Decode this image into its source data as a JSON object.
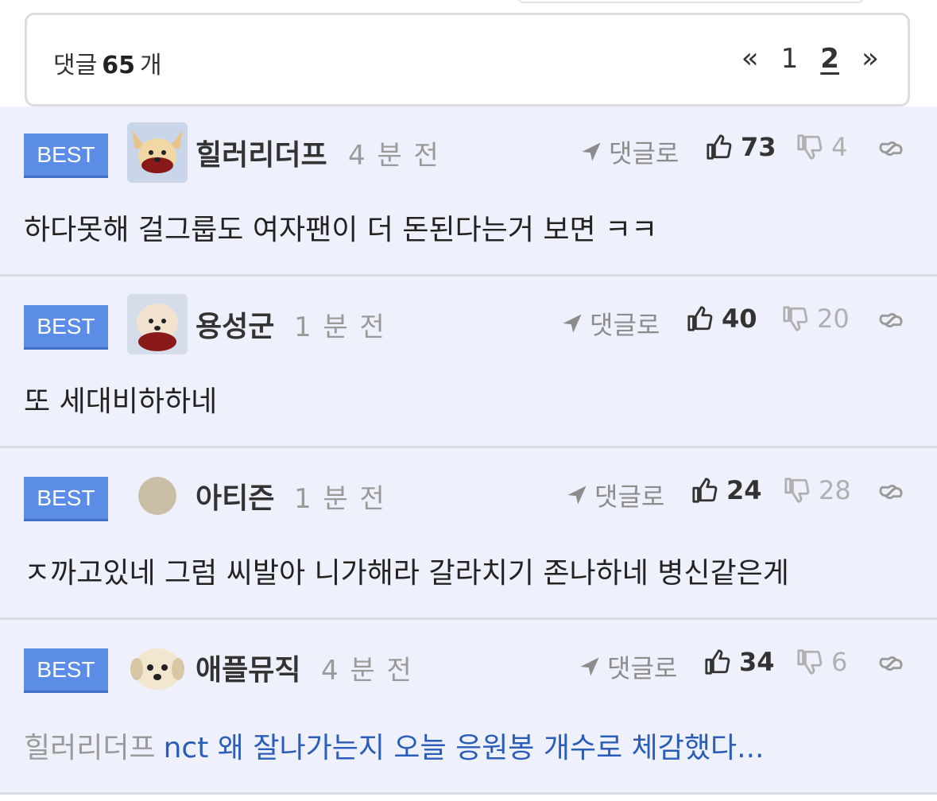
{
  "header": {
    "count_prefix": "댓글",
    "count": "65",
    "count_suffix": "개",
    "pager": {
      "prev": "«",
      "pages": [
        "1",
        "2"
      ],
      "current": "2",
      "next": "»"
    }
  },
  "colors": {
    "best_badge": "#5b8de6",
    "background": "#eef1fb",
    "link_text": "#2a5db9"
  },
  "comments": [
    {
      "badge": "BEST",
      "avatar": "dog-avatar-icon",
      "user": "힐러리더프",
      "time": "4 분 전",
      "reply": "댓글로",
      "likes": "73",
      "dislikes": "4",
      "body": "하다못해 걸그룹도 여자팬이 더 돈된다는거 보면 ㅋㅋ",
      "mention": ""
    },
    {
      "badge": "BEST",
      "avatar": "dog-avatar-icon",
      "user": "용성군",
      "time": "1 분 전",
      "reply": "댓글로",
      "likes": "40",
      "dislikes": "20",
      "body": "또 세대비하하네",
      "mention": ""
    },
    {
      "badge": "BEST",
      "avatar": "default-avatar-icon",
      "user": "아티즌",
      "time": "1 분 전",
      "reply": "댓글로",
      "likes": "24",
      "dislikes": "28",
      "body": "ㅈ까고있네 그럼 씨발아 니가해라 갈라치기 존나하네 병신같은게",
      "mention": ""
    },
    {
      "badge": "BEST",
      "avatar": "dog-avatar-icon",
      "user": "애플뮤직",
      "time": "4 분 전",
      "reply": "댓글로",
      "likes": "34",
      "dislikes": "6",
      "body": "nct 왜 잘나가는지 오늘 응원봉 개수로 체감했다...",
      "mention": "힐러리더프"
    }
  ]
}
